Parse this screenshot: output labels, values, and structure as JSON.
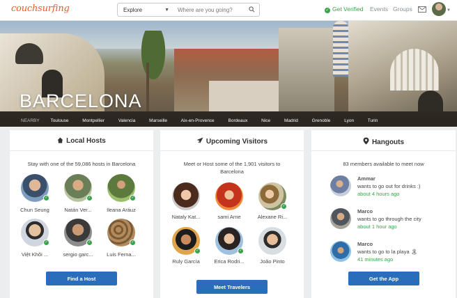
{
  "header": {
    "logo": "couchsurfing",
    "explore_label": "Explore",
    "search_placeholder": "Where are you going?",
    "get_verified": "Get Verified",
    "nav": [
      "Events",
      "Groups"
    ],
    "icons": [
      "search-icon",
      "check-icon",
      "mail-icon",
      "avatar",
      "chevron-down-icon"
    ],
    "accent_color": "#f05a28",
    "verified_color": "#3aa34a"
  },
  "hero": {
    "city": "BARCELONA",
    "nearby_label": "NEARBY",
    "nearby_cities": [
      "Toulouse",
      "Montpellier",
      "Valencia",
      "Marseille",
      "Aix-en-Provence",
      "Bordeaux",
      "Nice",
      "Madrid",
      "Grenoble",
      "Lyon",
      "Turin"
    ]
  },
  "local_hosts": {
    "title": "Local Hosts",
    "icon": "home-icon",
    "subtitle": "Stay with one of the 59,086 hosts in Barcelona",
    "people": [
      {
        "name": "Chun Seung",
        "verified": true
      },
      {
        "name": "Natán Ver...",
        "verified": true
      },
      {
        "name": "Ileana Aráuz",
        "verified": true
      },
      {
        "name": "Việt Khôi ...",
        "verified": true
      },
      {
        "name": "sergio garc...",
        "verified": true
      },
      {
        "name": "Luis Ferna...",
        "verified": true
      }
    ],
    "button": "Find a Host"
  },
  "upcoming_visitors": {
    "title": "Upcoming Visitors",
    "icon": "plane-icon",
    "subtitle": "Meet or Host some of the 1,901 visitors to Barcelona",
    "people": [
      {
        "name": "Nataly Kat...",
        "verified": false
      },
      {
        "name": "sami Arne",
        "verified": false
      },
      {
        "name": "Alexane Ri...",
        "verified": true
      },
      {
        "name": "Ruly García",
        "verified": true
      },
      {
        "name": "Erica Rodri...",
        "verified": true
      },
      {
        "name": "João Pinto",
        "verified": false
      }
    ],
    "button": "Meet Travelers"
  },
  "hangouts": {
    "title": "Hangouts",
    "icon": "map-pin-icon",
    "subtitle": "83 members available to meet now",
    "items": [
      {
        "name": "Ammar",
        "activity": "wants to go out for drinks :)",
        "time": "about 4 hours ago"
      },
      {
        "name": "Marco",
        "activity": "wants to go through the city",
        "time": "about 1 hour ago"
      },
      {
        "name": "Marco",
        "activity": "wants to go to la playa 🏝",
        "time": "41 minutes ago"
      }
    ],
    "button": "Get the App"
  }
}
